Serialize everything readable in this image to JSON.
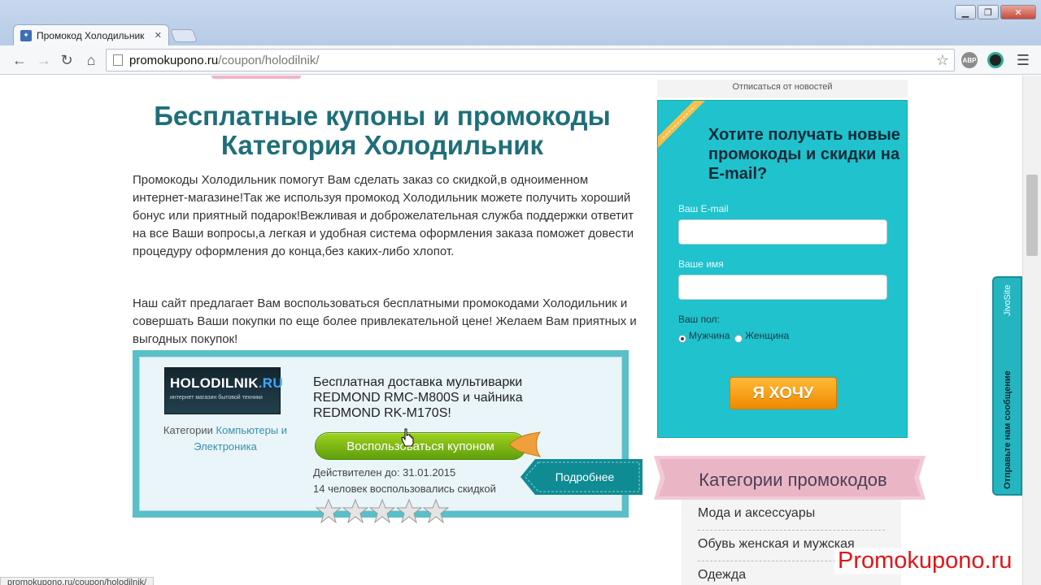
{
  "browser": {
    "tab_title": "Промокод Холодильник",
    "url_host": "promokupono.ru",
    "url_path": "/coupon/holodilnik/",
    "status_url": "promokupono.ru/coupon/holodilnik/",
    "extension_label": "ABP"
  },
  "main": {
    "heading_line1": "Бесплатные купоны и промокоды",
    "heading_line2": "Категория Холодильник",
    "paragraph1": "Промокоды Холодильник помогут Вам сделать заказ со скидкой,в одноименном интернет-магазине!Так же используя промокод Холодильник можете получить хороший бонус или приятный подарок!Вежливая и доброжелательная служба поддержки ответит на все Ваши вопросы,а легкая и удобная система оформления заказа поможет довести процедуру оформления до конца,без каких-либо хлопот.",
    "paragraph2": "Наш сайт предлагает Вам воспользоваться бесплатными промокодами Холодильник и совершать Ваши покупки по еще более привлекательной цене! Желаем Вам приятных и выгодных покупок!"
  },
  "coupon": {
    "logo_name_a": "HOLODILNIK",
    "logo_name_b": ".RU",
    "logo_subtitle": "интернет магазин бытовой техники",
    "category_prefix": "Категории",
    "category_link": "Компьютеры и Электроника",
    "title": "Бесплатная доставка мультиварки REDMOND RMC-M800S и чайника REDMOND RK-M170S!",
    "use_button": "Воспользоваться купоном",
    "valid_until": "Действителен до: 31.01.2015",
    "used_count": "14 человек воспользовались скидкой",
    "more_button": "Подробнее",
    "rating": 0,
    "rating_max": 5
  },
  "sidebar": {
    "unsubscribe": "Отписаться от новостей",
    "subscribe_heading": "Хотите получать новые промокоды и скидки на E-mail?",
    "email_label": "Ваш E-mail",
    "name_label": "Ваше имя",
    "gender_label": "Ваш пол:",
    "gender_male": "Мужчина",
    "gender_female": "Женщина",
    "submit_button": "Я ХОЧУ",
    "categories_title": "Категории промокодов",
    "categories": [
      "Мода и аксессуары",
      "Обувь женская и мужская",
      "Одежда"
    ]
  },
  "chat": {
    "label": "Отправьте нам сообщение",
    "brand": "JivoSite"
  },
  "watermark": "Promokupono.ru",
  "colors": {
    "heading": "#1f6f79",
    "subscribe_bg": "#1fc2cd",
    "use_button": "#7fbf15",
    "submit_button": "#f4a020",
    "watermark": "#e0161a"
  }
}
